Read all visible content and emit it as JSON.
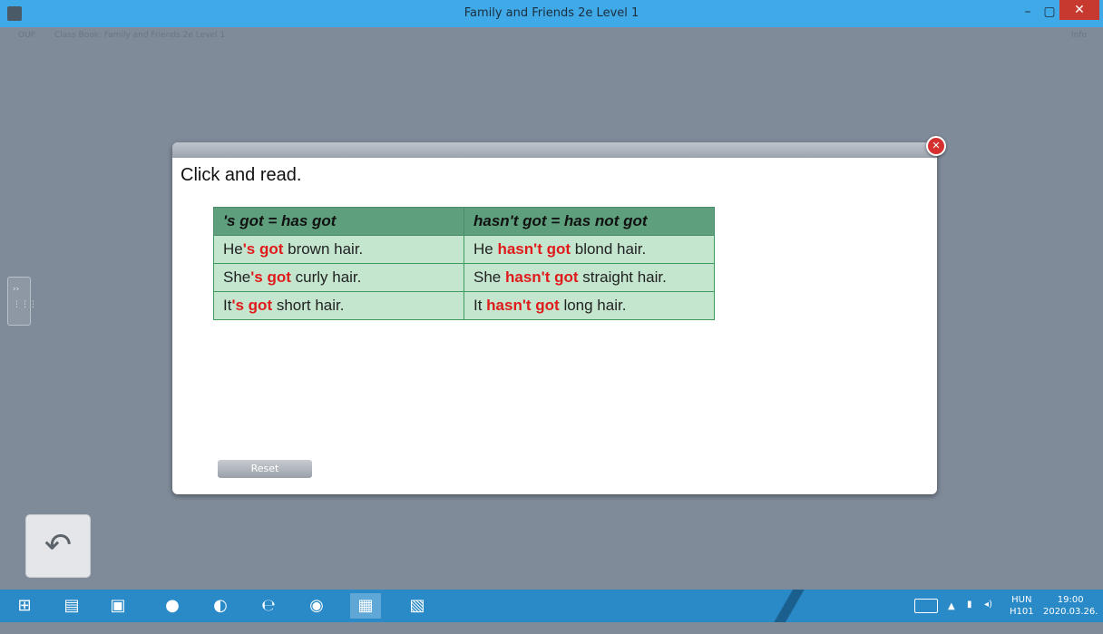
{
  "window": {
    "title": "Family and Friends 2e Level 1",
    "app_icon": "app-icon",
    "minimize_icon": "–",
    "maximize_icon": "▢",
    "close_icon": "✕"
  },
  "breadcrumb": {
    "items": [
      "OUP",
      "Class Book: Family and Friends 2e Level 1"
    ],
    "right_label": "Info"
  },
  "dialog": {
    "title": "Click and read.",
    "headers": [
      "'s got = has got",
      "hasn't got = has not got"
    ],
    "rows": [
      [
        {
          "pre": "He",
          "hl": "'s got",
          "post": " brown hair."
        },
        {
          "pre": "He ",
          "hl": "hasn't got",
          "post": " blond hair."
        }
      ],
      [
        {
          "pre": "She",
          "hl": "'s got",
          "post": " curly hair."
        },
        {
          "pre": "She ",
          "hl": "hasn't got",
          "post": " straight hair."
        }
      ],
      [
        {
          "pre": "It",
          "hl": "'s got",
          "post": " short hair."
        },
        {
          "pre": "It ",
          "hl": "hasn't got",
          "post": " long hair."
        }
      ]
    ],
    "reset_label": "Reset",
    "close_icon": "✕"
  },
  "side_tab": {
    "top_glyph": "››",
    "bottom_glyph": "⋮⋮⋮"
  },
  "back_button_glyph": "↶",
  "taskbar": {
    "icons": [
      "windows-icon",
      "file-explorer-icon",
      "store-icon",
      "firefox-icon",
      "steam-icon",
      "internet-explorer-icon",
      "chrome-icon",
      "app-icon",
      "word-icon"
    ],
    "tray": {
      "lang_top": "HUN",
      "lang_bottom": "H101",
      "time": "19:00",
      "date": "2020.03.26."
    }
  },
  "colors": {
    "highlight": "#e01b1b",
    "table_header": "#5e9f7d",
    "table_cell": "#c4e6cf",
    "titlebar": "#40a9e8",
    "taskbar": "#2a8ac8"
  }
}
